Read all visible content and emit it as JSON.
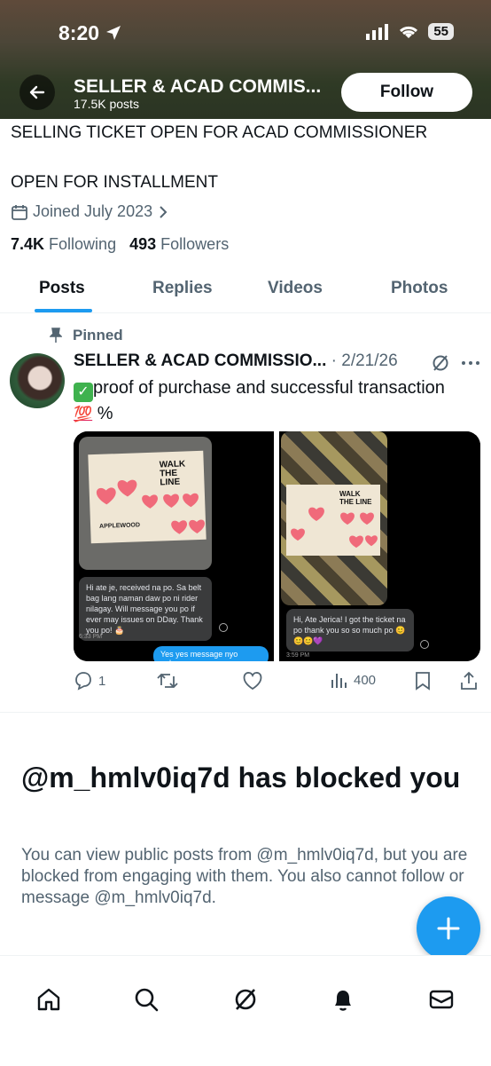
{
  "status_bar": {
    "time": "8:20",
    "battery": "55"
  },
  "header": {
    "title": "SELLER & ACAD COMMIS...",
    "posts_count": "17.5K posts",
    "follow_label": "Follow"
  },
  "profile": {
    "bio_line1": "SELLING TICKET OPEN FOR ACAD COMMISSIONER",
    "bio_line2": "OPEN FOR INSTALLMENT",
    "joined": "Joined July 2023",
    "following_count": "7.4K",
    "following_label": "Following",
    "followers_count": "493",
    "followers_label": "Followers"
  },
  "tabs": [
    "Posts",
    "Replies",
    "Videos",
    "Photos"
  ],
  "pinned_post": {
    "pinned_label": "Pinned",
    "author": "SELLER & ACAD COMMISSIO...",
    "date": "· 2/21/26",
    "text": "proof of purchase and successful transaction",
    "emoji_suffix": "💯",
    "percent": "%",
    "media": {
      "left_message": "Hi ate je, received na po. Sa belt bag lang naman daw po ni rider nilagay. Will message you po if ever may issues on DDay. Thank you po! 🎂",
      "left_time": "6:33 PM",
      "left_reply": "Yes yes message nyo nalang",
      "right_message": "Hi, Ate Jerica! I got the ticket na po thank you so so much po 😊",
      "right_emojis": "😊😊💜",
      "right_time": "3:59 PM",
      "ticket_title": "WALK THE LINE",
      "ticket_venue": "APPLEWOOD"
    },
    "actions": {
      "replies": "1",
      "views": "400"
    }
  },
  "blocked": {
    "title": "@m_hmlv0iq7d has blocked you",
    "text": "You can view public posts from @m_hmlv0iq7d, but you are blocked from engaging with them. You also cannot follow or message @m_hmlv0iq7d."
  },
  "colors": {
    "accent": "#1d9bf0",
    "secondary_text": "#536471"
  }
}
